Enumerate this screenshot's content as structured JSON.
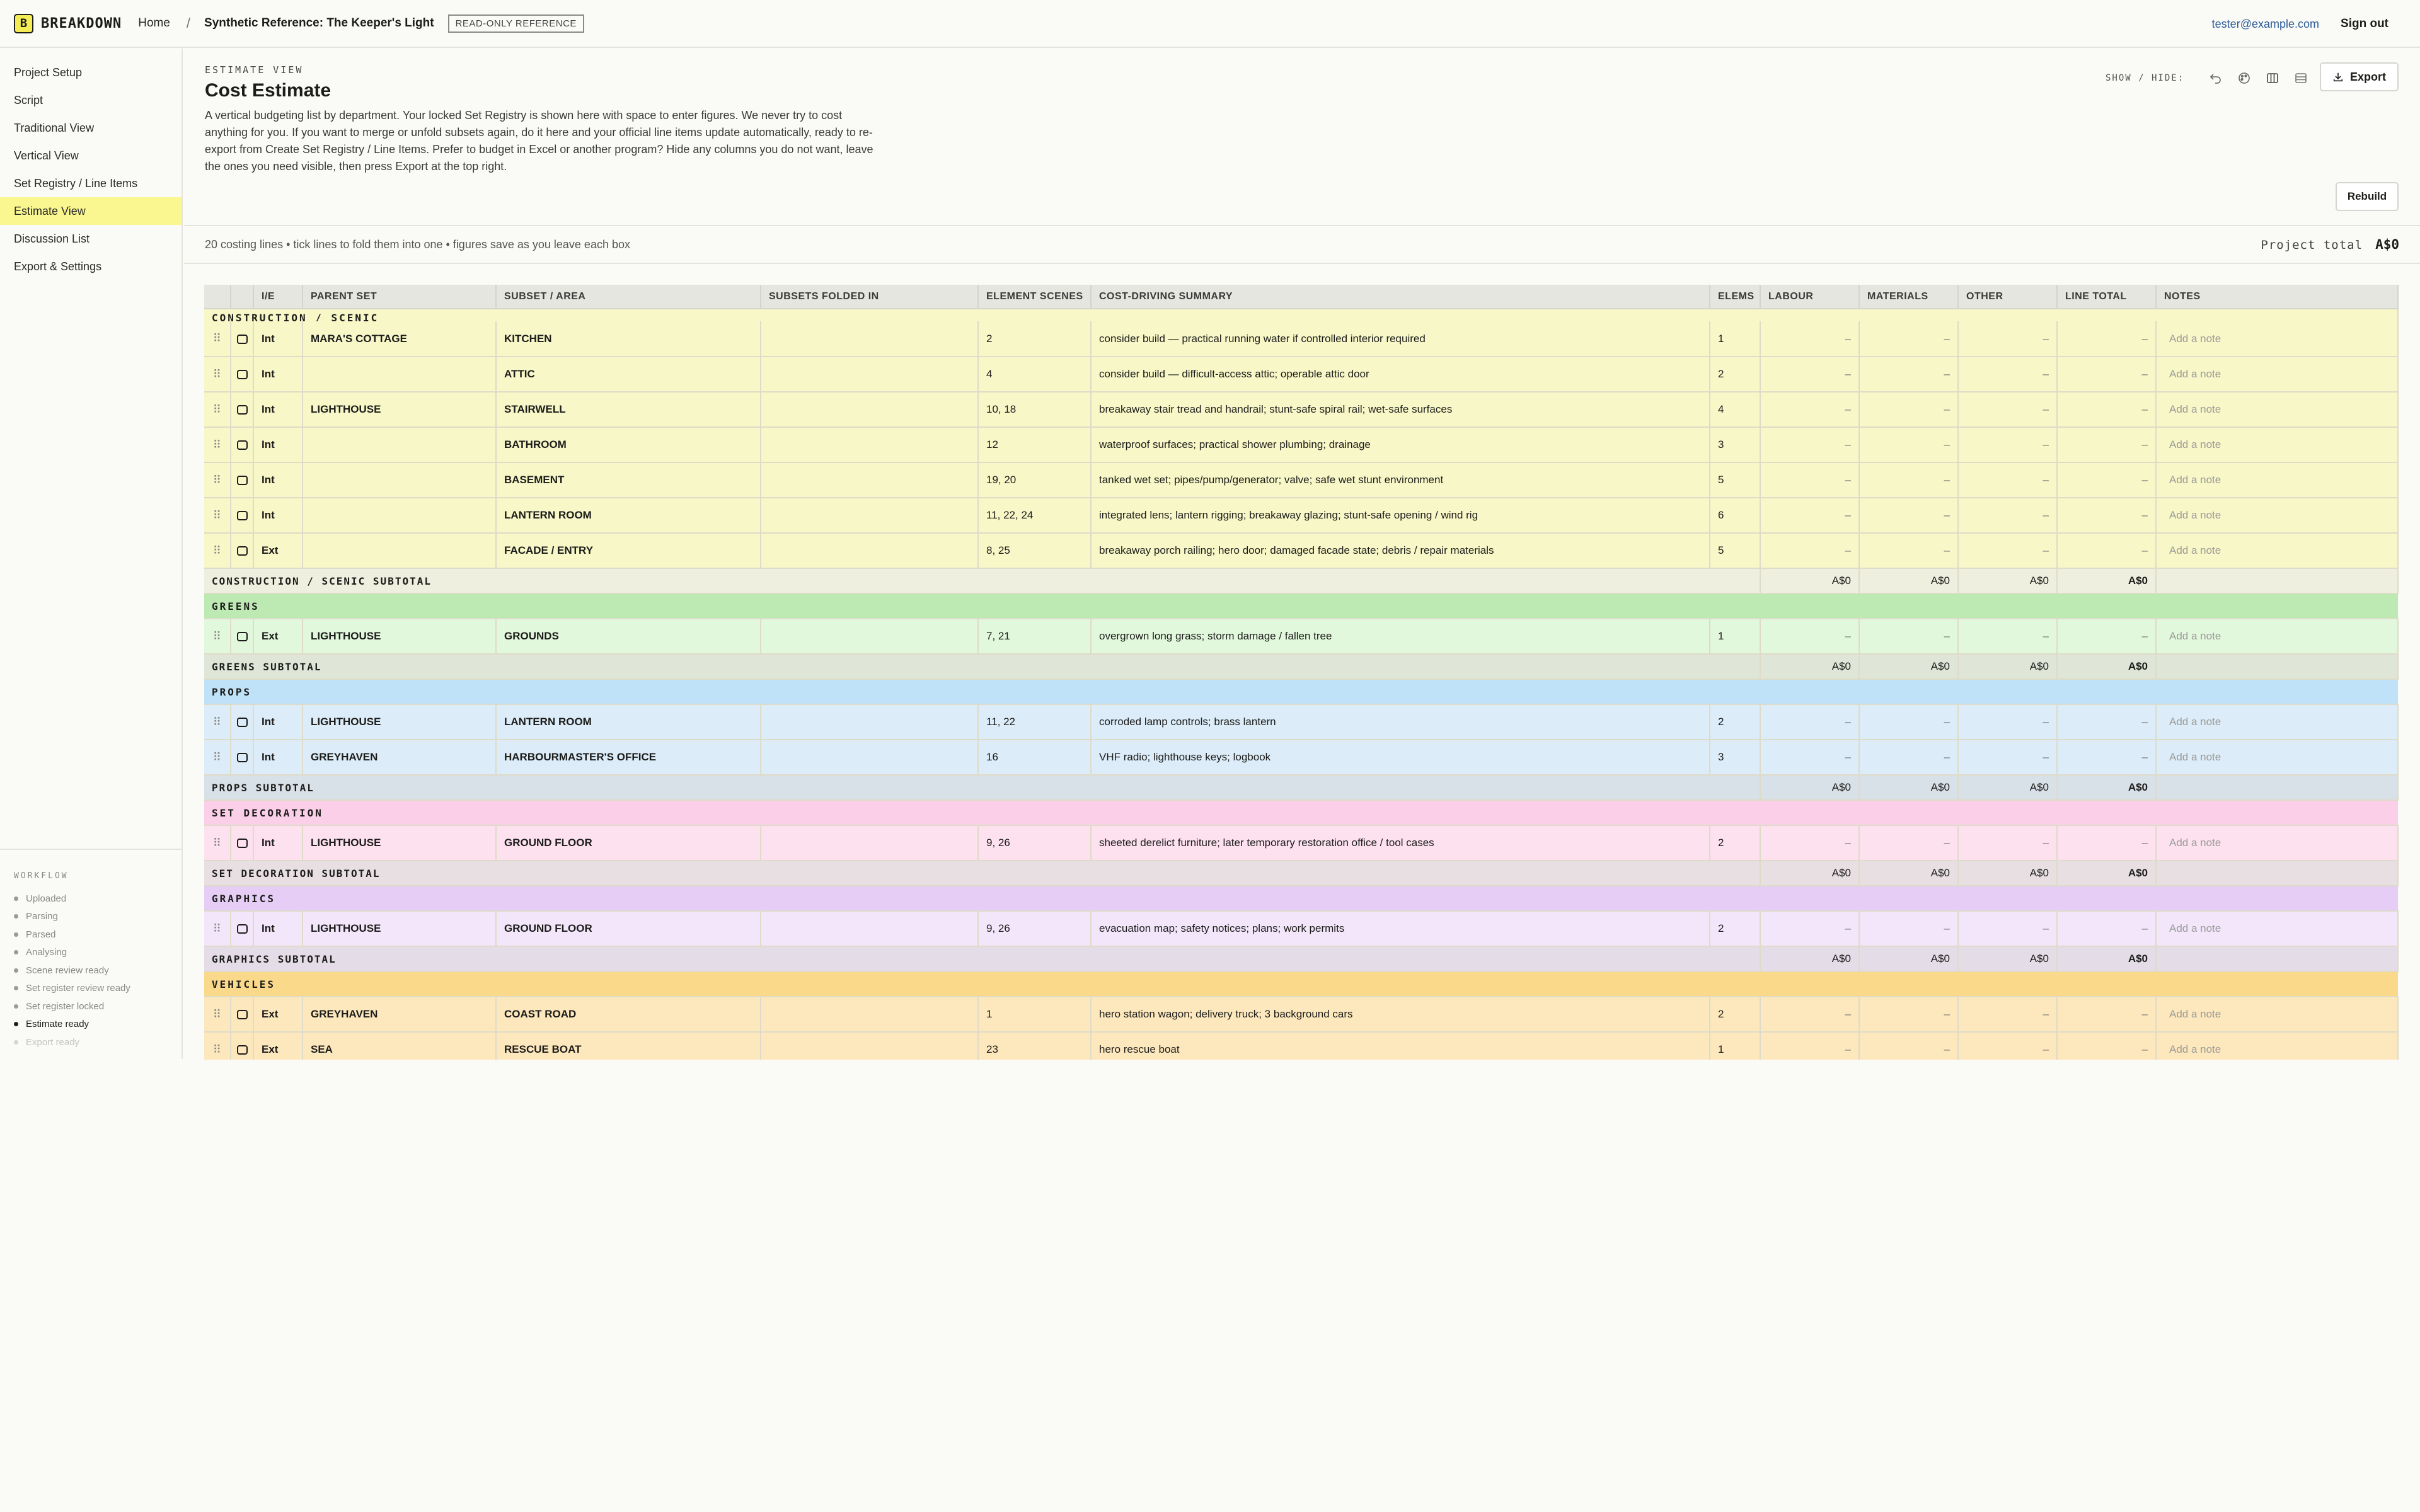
{
  "app": {
    "logo_mark": "B",
    "logo_text": "BREAKDOWN"
  },
  "header": {
    "home": "Home",
    "separator": "/",
    "project_title": "Synthetic Reference: The Keeper's Light",
    "badge": "READ-ONLY REFERENCE",
    "user_email": "tester@example.com",
    "sign_out": "Sign out"
  },
  "sidebar": {
    "items": [
      {
        "label": "Project Setup"
      },
      {
        "label": "Script"
      },
      {
        "label": "Traditional View"
      },
      {
        "label": "Vertical View"
      },
      {
        "label": "Set Registry / Line Items"
      },
      {
        "label": "Estimate View"
      },
      {
        "label": "Discussion List"
      },
      {
        "label": "Export & Settings"
      }
    ],
    "active": "Estimate View",
    "workflow_title": "WORKFLOW",
    "workflow": [
      {
        "label": "Uploaded"
      },
      {
        "label": "Parsing"
      },
      {
        "label": "Parsed"
      },
      {
        "label": "Analysing"
      },
      {
        "label": "Scene review ready"
      },
      {
        "label": "Set register review ready"
      },
      {
        "label": "Set register locked"
      },
      {
        "label": "Estimate ready"
      },
      {
        "label": "Export ready"
      }
    ],
    "workflow_current": "Estimate ready"
  },
  "page": {
    "eyebrow": "ESTIMATE VIEW",
    "title": "Cost Estimate",
    "description": "A vertical budgeting list by department. Your locked Set Registry is shown here with space to enter figures. We never try to cost anything for you. If you want to merge or unfold subsets again, do it here and your official line items update automatically, ready to re-export from Create Set Registry / Line Items. Prefer to budget in Excel or another program? Hide any columns you do not want, leave the ones you need visible, then press Export at the top right.",
    "show_hide_label": "SHOW / HIDE:",
    "show_hide_icons": [
      "undo-icon",
      "palette-icon",
      "columns-icon",
      "rows-icon"
    ],
    "export_label": "Export",
    "rebuild_label": "Rebuild",
    "summary": "20 costing lines • tick lines to fold them into one • figures save as you leave each box",
    "project_total_label": "Project total",
    "project_total_value": "A$0"
  },
  "table": {
    "columns": [
      "",
      "",
      "I/E",
      "PARENT SET",
      "SUBSET / AREA",
      "SUBSETS FOLDED IN",
      "ELEMENT SCENES",
      "COST-DRIVING SUMMARY",
      "ELEMS",
      "LABOUR",
      "MATERIALS",
      "OTHER",
      "LINE TOTAL",
      "NOTES"
    ],
    "empty_value": "–",
    "note_placeholder": "Add a note",
    "sections": [
      {
        "name": "CONSTRUCTION / SCENIC",
        "rows": [
          {
            "ie": "Int",
            "parent": "MARA'S COTTAGE",
            "subset": "KITCHEN",
            "folded": "",
            "scenes": "2",
            "summary": "consider build — practical running water if controlled interior required",
            "elems": "1"
          },
          {
            "ie": "Int",
            "parent": "",
            "subset": "ATTIC",
            "folded": "",
            "scenes": "4",
            "summary": "consider build — difficult-access attic; operable attic door",
            "elems": "2"
          },
          {
            "ie": "Int",
            "parent": "LIGHTHOUSE",
            "subset": "STAIRWELL",
            "folded": "",
            "scenes": "10, 18",
            "summary": "breakaway stair tread and handrail; stunt-safe spiral rail; wet-safe surfaces",
            "elems": "4"
          },
          {
            "ie": "Int",
            "parent": "",
            "subset": "BATHROOM",
            "folded": "",
            "scenes": "12",
            "summary": "waterproof surfaces; practical shower plumbing; drainage",
            "elems": "3"
          },
          {
            "ie": "Int",
            "parent": "",
            "subset": "BASEMENT",
            "folded": "",
            "scenes": "19, 20",
            "summary": "tanked wet set; pipes/pump/generator; valve; safe wet stunt environment",
            "elems": "5"
          },
          {
            "ie": "Int",
            "parent": "",
            "subset": "LANTERN ROOM",
            "folded": "",
            "scenes": "11, 22, 24",
            "summary": "integrated lens; lantern rigging; breakaway glazing; stunt-safe opening / wind rig",
            "elems": "6"
          },
          {
            "ie": "Ext",
            "parent": "",
            "subset": "FACADE / ENTRY",
            "folded": "",
            "scenes": "8, 25",
            "summary": "breakaway porch railing; hero door; damaged facade state; debris / repair materials",
            "elems": "5"
          }
        ],
        "subtotal_label": "CONSTRUCTION / SCENIC SUBTOTAL",
        "subtotal": {
          "labour": "A$0",
          "materials": "A$0",
          "other": "A$0",
          "total": "A$0"
        }
      },
      {
        "name": "GREENS",
        "rows": [
          {
            "ie": "Ext",
            "parent": "LIGHTHOUSE",
            "subset": "GROUNDS",
            "folded": "",
            "scenes": "7, 21",
            "summary": "overgrown long grass; storm damage / fallen tree",
            "elems": "1"
          }
        ],
        "subtotal_label": "GREENS SUBTOTAL",
        "subtotal": {
          "labour": "A$0",
          "materials": "A$0",
          "other": "A$0",
          "total": "A$0"
        }
      },
      {
        "name": "PROPS",
        "rows": [
          {
            "ie": "Int",
            "parent": "LIGHTHOUSE",
            "subset": "LANTERN ROOM",
            "folded": "",
            "scenes": "11, 22",
            "summary": "corroded lamp controls; brass lantern",
            "elems": "2"
          },
          {
            "ie": "Int",
            "parent": "GREYHAVEN",
            "subset": "HARBOURMASTER'S OFFICE",
            "folded": "",
            "scenes": "16",
            "summary": "VHF radio; lighthouse keys; logbook",
            "elems": "3"
          }
        ],
        "subtotal_label": "PROPS SUBTOTAL",
        "subtotal": {
          "labour": "A$0",
          "materials": "A$0",
          "other": "A$0",
          "total": "A$0"
        }
      },
      {
        "name": "SET DECORATION",
        "rows": [
          {
            "ie": "Int",
            "parent": "LIGHTHOUSE",
            "subset": "GROUND FLOOR",
            "folded": "",
            "scenes": "9, 26",
            "summary": "sheeted derelict furniture; later temporary restoration office / tool cases",
            "elems": "2"
          }
        ],
        "subtotal_label": "SET DECORATION SUBTOTAL",
        "subtotal": {
          "labour": "A$0",
          "materials": "A$0",
          "other": "A$0",
          "total": "A$0"
        }
      },
      {
        "name": "GRAPHICS",
        "rows": [
          {
            "ie": "Int",
            "parent": "LIGHTHOUSE",
            "subset": "GROUND FLOOR",
            "folded": "",
            "scenes": "9, 26",
            "summary": "evacuation map; safety notices; plans; work permits",
            "elems": "2"
          }
        ],
        "subtotal_label": "GRAPHICS SUBTOTAL",
        "subtotal": {
          "labour": "A$0",
          "materials": "A$0",
          "other": "A$0",
          "total": "A$0"
        }
      },
      {
        "name": "VEHICLES",
        "rows": [
          {
            "ie": "Ext",
            "parent": "GREYHAVEN",
            "subset": "COAST ROAD",
            "folded": "",
            "scenes": "1",
            "summary": "hero station wagon; delivery truck; 3 background cars",
            "elems": "2"
          },
          {
            "ie": "Ext",
            "parent": "SEA",
            "subset": "RESCUE BOAT",
            "folded": "",
            "scenes": "23",
            "summary": "hero rescue boat",
            "elems": "1"
          }
        ]
      }
    ]
  }
}
